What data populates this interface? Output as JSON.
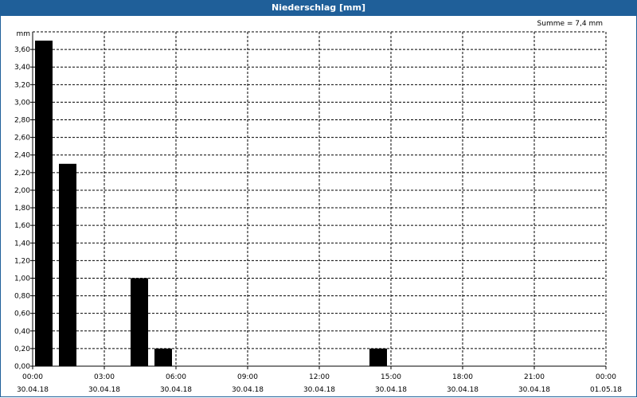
{
  "window": {
    "title": "Niederschlag [mm]"
  },
  "chart_data": {
    "type": "bar",
    "title": "Niederschlag [mm]",
    "ylabel": "mm",
    "annotation": "Summe = 7,4 mm",
    "ylim": [
      0,
      3.8
    ],
    "yticks": [
      0,
      0.2,
      0.4,
      0.6,
      0.8,
      1.0,
      1.2,
      1.4,
      1.6,
      1.8,
      2.0,
      2.2,
      2.4,
      2.6,
      2.8,
      3.0,
      3.2,
      3.4,
      3.6
    ],
    "ytick_labels": [
      "0,00",
      "0,20",
      "0,40",
      "0,60",
      "0,80",
      "1,00",
      "1,20",
      "1,40",
      "1,60",
      "1,80",
      "2,00",
      "2,20",
      "2,40",
      "2,60",
      "2,80",
      "3,00",
      "3,20",
      "3,40",
      "3,60"
    ],
    "x_range_hours": [
      0,
      24
    ],
    "xticks": [
      {
        "hour": 0,
        "time": "00:00",
        "date": "30.04.18"
      },
      {
        "hour": 3,
        "time": "03:00",
        "date": "30.04.18"
      },
      {
        "hour": 6,
        "time": "06:00",
        "date": "30.04.18"
      },
      {
        "hour": 9,
        "time": "09:00",
        "date": "30.04.18"
      },
      {
        "hour": 12,
        "time": "12:00",
        "date": "30.04.18"
      },
      {
        "hour": 15,
        "time": "15:00",
        "date": "30.04.18"
      },
      {
        "hour": 18,
        "time": "18:00",
        "date": "30.04.18"
      },
      {
        "hour": 21,
        "time": "21:00",
        "date": "30.04.18"
      },
      {
        "hour": 24,
        "time": "00:00",
        "date": "01.05.18"
      }
    ],
    "bars": [
      {
        "hour": 0,
        "value": 3.7
      },
      {
        "hour": 1,
        "value": 2.3
      },
      {
        "hour": 4,
        "value": 1.0
      },
      {
        "hour": 5,
        "value": 0.2
      },
      {
        "hour": 14,
        "value": 0.2
      }
    ],
    "grid": true,
    "bar_color": "#000000",
    "title_bar_color": "#1f5f99"
  }
}
